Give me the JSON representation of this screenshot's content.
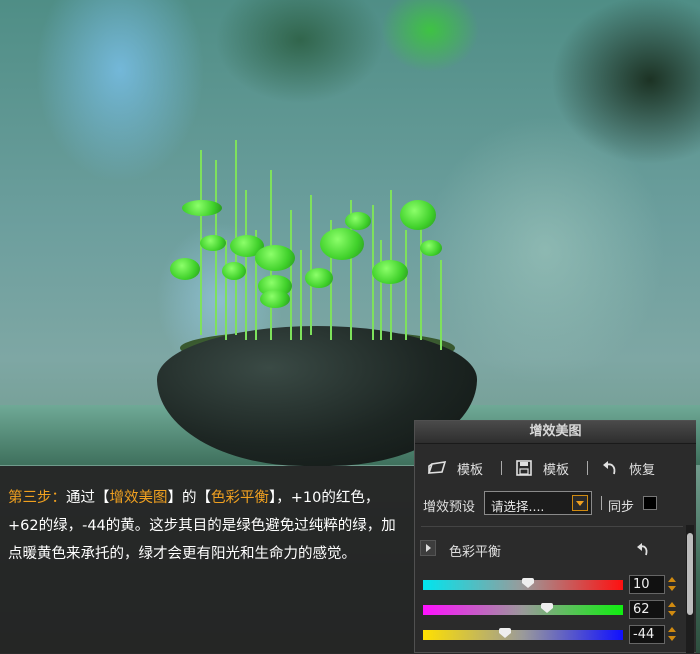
{
  "caption": {
    "step": "第三步：",
    "t1": "通过【",
    "panel_name": "增效美图",
    "t2": "】的【",
    "tool_name": "色彩平衡",
    "t3": "】，+10的红色，+62的绿，-44的黄。这步其目的是绿色避免过纯粹的绿，加点暖黄色来承托的，绿才会更有阳光和生命力的感觉。"
  },
  "panel": {
    "title": "增效美图",
    "toolbar": {
      "open_label": "模板",
      "save_label": "模板",
      "restore_label": "恢复"
    },
    "preset": {
      "label": "增效预设",
      "value": "请选择....",
      "sync_label": "同步",
      "sync_checked": false
    },
    "section": {
      "title": "色彩平衡",
      "sliders": [
        {
          "name": "cyan-red",
          "value": "10",
          "from": "#00e5ee",
          "to": "#ff1010",
          "level": 0.525
        },
        {
          "name": "magenta-green",
          "value": "62",
          "from": "#ff10ff",
          "to": "#10ee10",
          "level": 0.62
        },
        {
          "name": "yellow-blue",
          "value": "-44",
          "from": "#ffe000",
          "to": "#1010ff",
          "level": 0.41
        }
      ]
    }
  },
  "colors": {
    "accent": "#f0a020",
    "panel_bg": "#2b2b2b"
  }
}
